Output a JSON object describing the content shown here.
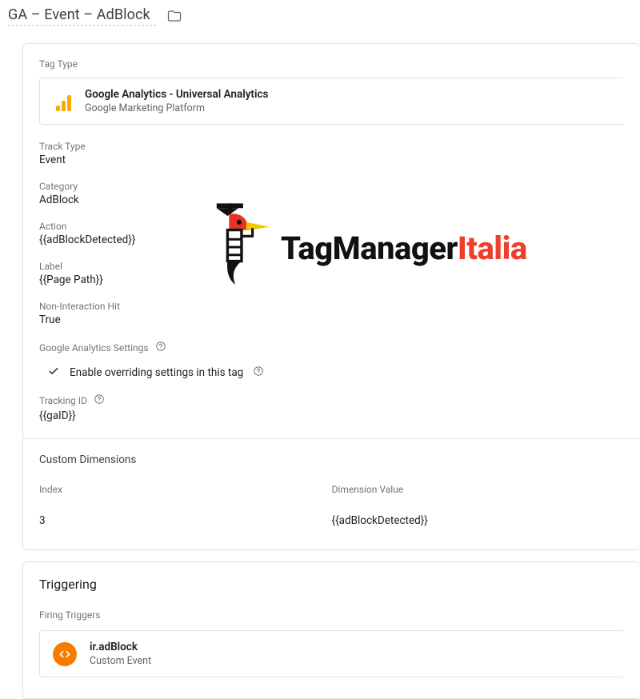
{
  "header": {
    "title": "GA – Event – AdBlock"
  },
  "main": {
    "tagTypeLabel": "Tag Type",
    "tagType": {
      "title": "Google Analytics - Universal Analytics",
      "subtitle": "Google Marketing Platform"
    },
    "fields": {
      "trackTypeLabel": "Track Type",
      "trackTypeValue": "Event",
      "categoryLabel": "Category",
      "categoryValue": "AdBlock",
      "actionLabel": "Action",
      "actionValue": "{{adBlockDetected}}",
      "labelLabel": "Label",
      "labelValue": "{{Page Path}}",
      "nonInteractionLabel": "Non-Interaction Hit",
      "nonInteractionValue": "True",
      "gaSettingsLabel": "Google Analytics Settings",
      "overrideLabel": "Enable overriding settings in this tag",
      "trackingIdLabel": "Tracking ID",
      "trackingIdValue": "{{gaID}}"
    },
    "customDimensions": {
      "title": "Custom Dimensions",
      "indexHeader": "Index",
      "valueHeader": "Dimension Value",
      "row": {
        "index": "3",
        "value": "{{adBlockDetected}}"
      }
    }
  },
  "triggering": {
    "title": "Triggering",
    "firingLabel": "Firing Triggers",
    "item": {
      "title": "ir.adBlock",
      "subtitle": "Custom Event"
    }
  },
  "watermark": {
    "black": "TagManager",
    "red": "Italia"
  }
}
